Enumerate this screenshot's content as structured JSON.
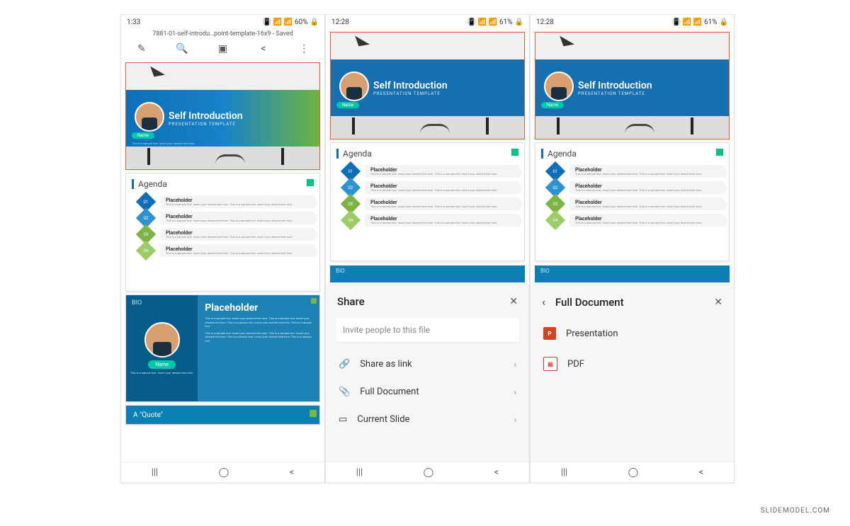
{
  "watermark": "SLIDEMODEL.COM",
  "status": {
    "time1": "1:33",
    "time2": "12:28",
    "batt1": "60%",
    "batt2": "61%",
    "sig": "📶"
  },
  "titlebar": "7881-01-self-introdu…point-template-16x9 - Saved",
  "slide": {
    "title": "Self Introduction",
    "subtitle": "PRESENTATION TEMPLATE",
    "name": "Name",
    "caption": "This is a sample text. Insert\nyour desired text here.",
    "agenda": {
      "head": "Agenda",
      "item": "Placeholder",
      "desc": "This is a sample text. Insert your desired text here. This is a sample text. Insert your desired text here.",
      "nums": [
        "01",
        "02",
        "03",
        "04"
      ]
    },
    "bio": {
      "head": "BIO",
      "title": "Placeholder",
      "name": "Name",
      "caption": "This is a sample text.\nInsert your desired text here.",
      "para": "This is a sample text. Insert your desired text here. This is a sample text. Insert your desired text here. This is a sample text. Insert your desired text here. This is a sample text."
    },
    "quote": "A \"Quote\""
  },
  "share": {
    "title": "Share",
    "invite": "Invite people to this file",
    "link": "Share as link",
    "full": "Full Document",
    "current": "Current Slide"
  },
  "fulldoc": {
    "title": "Full Document",
    "presentation": "Presentation",
    "pdf": "PDF"
  }
}
